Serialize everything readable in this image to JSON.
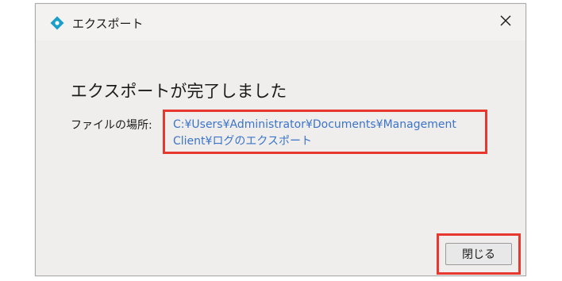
{
  "window": {
    "title": "エクスポート",
    "app_icon": "diamond-logo-icon",
    "close_icon": "close-icon"
  },
  "content": {
    "heading": "エクスポートが完了しました",
    "location_label": "ファイルの場所:",
    "path_line1": "C:¥Users¥Administrator¥Documents¥Management",
    "path_line2": "Client¥ログのエクスポート"
  },
  "buttons": {
    "close_label": "閉じる"
  },
  "colors": {
    "link": "#3b74c9",
    "highlight": "#e8372e",
    "icon_accent": "#1aa0c8"
  }
}
